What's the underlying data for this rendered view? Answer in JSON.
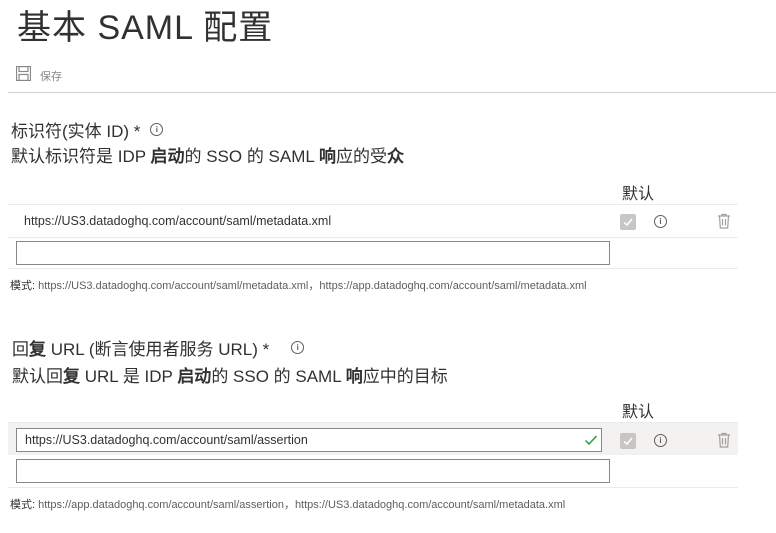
{
  "page": {
    "title": "基本 SAML 配置",
    "toolbar": {
      "save_label": "保存"
    }
  },
  "identifier": {
    "heading": "标识符(实体 ID) *",
    "desc_pre": "默认标识符是 IDP ",
    "desc_bold1": "启动",
    "desc_mid": "的 SSO 的 SAML ",
    "desc_bold2": "响",
    "desc_mid2": "应的受",
    "desc_bold3": "众",
    "default_col": "默认",
    "rows": [
      {
        "value": "https://US3.datadoghq.com/account/saml/metadata.xml",
        "default_checked": true
      }
    ],
    "new_input_value": "",
    "pattern_label": "模式: ",
    "pattern_value": "https://US3.datadoghq.com/account/saml/metadata.xml，https://app.datadoghq.com/account/saml/metadata.xml"
  },
  "reply_url": {
    "heading_pre": "回",
    "heading_bold": "复",
    "heading_post": " URL (断言使用者服务 URL) *",
    "desc_pre": "默认回",
    "desc_bold1": "复",
    "desc_mid": " URL 是 IDP ",
    "desc_bold2": "启动",
    "desc_mid2": "的 SSO 的 SAML ",
    "desc_bold3": "响",
    "desc_post": "应中的目标",
    "default_col": "默认",
    "rows": [
      {
        "value": "https://US3.datadoghq.com/account/saml/assertion",
        "default_checked": true,
        "valid": true
      }
    ],
    "new_input_value": "",
    "pattern_label": "模式: ",
    "pattern_value": "https://app.datadoghq.com/account/saml/assertion，https://US3.datadoghq.com/account/saml/metadata.xml"
  },
  "colors": {
    "valid_check": "#2e9e3a",
    "divider": "#d2d0ce",
    "highlight": "#f3f2f1"
  },
  "icons": [
    "save-icon",
    "info-icon",
    "checkbox-check-icon",
    "trash-icon",
    "valid-check-icon"
  ]
}
